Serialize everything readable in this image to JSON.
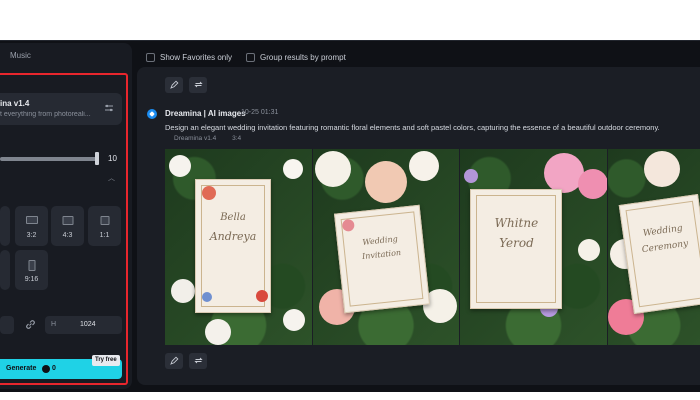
{
  "left_panel": {
    "tab_music": "Music",
    "model": {
      "name": "ina v1.4",
      "description": "t everything from photoreali..."
    },
    "slider": {
      "value": "10"
    },
    "aspect_ratios": [
      "3:2",
      "4:3",
      "1:1",
      "9:16"
    ],
    "size": {
      "height_label": "H",
      "height_value": "1024"
    },
    "generate": {
      "label": "Generate",
      "cost": "0",
      "badge": "Try free"
    }
  },
  "filters": {
    "show_favorites": "Show Favorites only",
    "group_by_prompt": "Group results by prompt"
  },
  "result": {
    "brand": "Dreamina | AI images",
    "time": "10-25  01:31",
    "prompt": "Design an elegant wedding invitation featuring romantic floral elements and soft pastel colors, capturing the essence of a beautiful outdoor ceremony.",
    "model": "Dreamina v1.4",
    "ratio": "3:4"
  },
  "colors": {
    "accent": "#1fd2e6",
    "highlight": "#e8262d"
  }
}
